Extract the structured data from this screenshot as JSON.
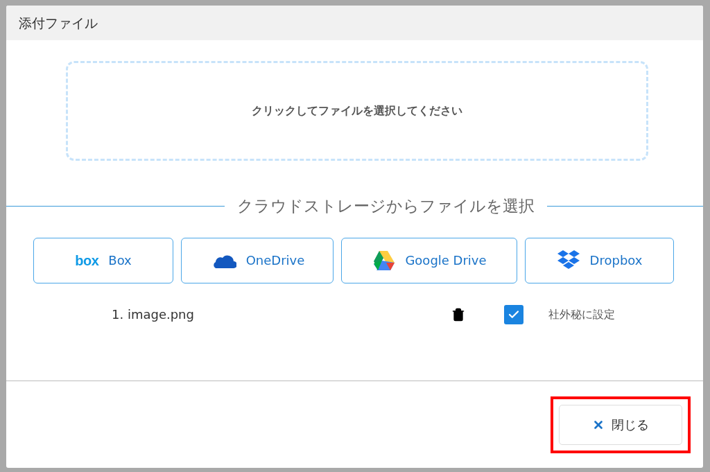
{
  "dialog": {
    "title": "添付ファイル",
    "drop_zone": {
      "text": "クリックしてファイルを選択してください"
    },
    "cloud_section": {
      "heading": "クラウドストレージからファイルを選択",
      "services": [
        {
          "kind": "box",
          "logo_text": "box",
          "label": "Box"
        },
        {
          "kind": "onedrive",
          "label": "OneDrive"
        },
        {
          "kind": "googledrive",
          "label": "Google Drive"
        },
        {
          "kind": "dropbox",
          "label": "Dropbox"
        }
      ]
    },
    "files": [
      {
        "name": "1. image.png",
        "confidential": {
          "checked": true,
          "label": "社外秘に設定"
        }
      }
    ],
    "footer": {
      "close_button": {
        "label": "閉じる",
        "highlighted": true
      }
    }
  }
}
